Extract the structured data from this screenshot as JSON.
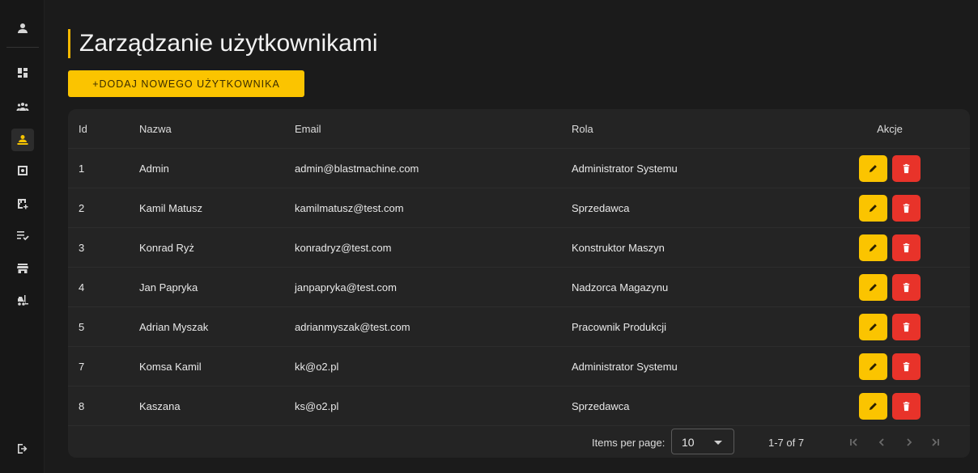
{
  "page": {
    "title": "Zarządzanie użytkownikami"
  },
  "toolbar": {
    "add_label": "+DODAJ NOWEGO UŻYTKOWNIKA"
  },
  "table": {
    "columns": {
      "id": "Id",
      "name": "Nazwa",
      "email": "Email",
      "role": "Rola",
      "actions": "Akcje"
    },
    "rows": [
      {
        "id": "1",
        "name": "Admin",
        "email": "admin@blastmachine.com",
        "role": "Administrator Systemu"
      },
      {
        "id": "2",
        "name": "Kamil Matusz",
        "email": "kamilmatusz@test.com",
        "role": "Sprzedawca"
      },
      {
        "id": "3",
        "name": "Konrad Ryż",
        "email": "konradryz@test.com",
        "role": "Konstruktor Maszyn"
      },
      {
        "id": "4",
        "name": "Jan Papryka",
        "email": "janpapryka@test.com",
        "role": "Nadzorca Magazynu"
      },
      {
        "id": "5",
        "name": "Adrian Myszak",
        "email": "adrianmyszak@test.com",
        "role": "Pracownik Produkcji"
      },
      {
        "id": "7",
        "name": "Komsa Kamil",
        "email": "kk@o2.pl",
        "role": "Administrator Systemu"
      },
      {
        "id": "8",
        "name": "Kaszana",
        "email": "ks@o2.pl",
        "role": "Sprzedawca"
      }
    ]
  },
  "paginator": {
    "items_per_page_label": "Items per page:",
    "page_size": "10",
    "range": "1-7 of 7"
  },
  "sidebar": {
    "icons": [
      "account-icon",
      "dashboard-icon",
      "groups-icon",
      "user-management-icon",
      "machine-icon",
      "table-add-icon",
      "checklist-icon",
      "store-icon",
      "forklift-icon",
      "logout-icon"
    ],
    "active": "user-management-icon"
  },
  "colors": {
    "accent": "#fbc400",
    "danger": "#e8332a",
    "background": "#1b1b1b",
    "card": "#242424"
  }
}
